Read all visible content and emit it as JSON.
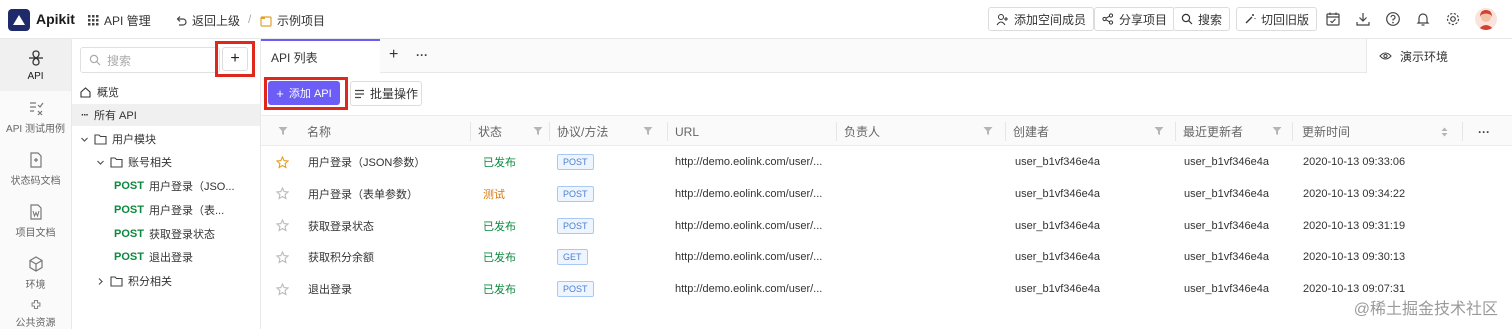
{
  "topbar": {
    "app_name": "Apikit",
    "api_manage": "API 管理",
    "back": "返回上级",
    "sep": "/",
    "project": "示例项目",
    "add_member": "添加空间成员",
    "share": "分享项目",
    "search": "搜索",
    "switch_old": "切回旧版"
  },
  "rail": {
    "items": [
      {
        "label": "API",
        "icon": "api-icon"
      },
      {
        "label": "API 测试用例",
        "icon": "test-case-icon"
      },
      {
        "label": "状态码文档",
        "icon": "status-doc-icon"
      },
      {
        "label": "项目文档",
        "icon": "word-doc-icon"
      },
      {
        "label": "环境",
        "icon": "environment-icon"
      },
      {
        "label": "公共资源",
        "icon": "public-resource-icon"
      }
    ]
  },
  "tree": {
    "search_placeholder": "搜索",
    "plus": "+",
    "overview": "概览",
    "all_api": "所有 API",
    "module_user": "用户模块",
    "group_account": "账号相关",
    "endpoints": [
      {
        "method": "POST",
        "name": "用户登录（JSO..."
      },
      {
        "method": "POST",
        "name": "用户登录（表..."
      },
      {
        "method": "POST",
        "name": "获取登录状态"
      },
      {
        "method": "POST",
        "name": "退出登录"
      }
    ],
    "group_points": "积分相关"
  },
  "tabs": {
    "active": "API 列表",
    "add": "+",
    "more": "···",
    "env": "演示环境"
  },
  "toolbar": {
    "add_api": "添加 API",
    "bulk": "批量操作"
  },
  "table": {
    "headers": [
      "名称",
      "状态",
      "协议/方法",
      "URL",
      "负责人",
      "创建者",
      "最近更新者",
      "更新时间"
    ],
    "more": "···",
    "rows": [
      {
        "starred": true,
        "name": "用户登录（JSON参数）",
        "status": "已发布",
        "status_type": "ok",
        "method": "POST",
        "url": "http://demo.eolink.com/user/...",
        "owner": "",
        "creator": "user_b1vf346e4a",
        "updater": "user_b1vf346e4a",
        "time": "2020-10-13 09:33:06"
      },
      {
        "starred": false,
        "name": "用户登录（表单参数）",
        "status": "测试",
        "status_type": "test",
        "method": "POST",
        "url": "http://demo.eolink.com/user/...",
        "owner": "",
        "creator": "user_b1vf346e4a",
        "updater": "user_b1vf346e4a",
        "time": "2020-10-13 09:34:22"
      },
      {
        "starred": false,
        "name": "获取登录状态",
        "status": "已发布",
        "status_type": "ok",
        "method": "POST",
        "url": "http://demo.eolink.com/user/...",
        "owner": "",
        "creator": "user_b1vf346e4a",
        "updater": "user_b1vf346e4a",
        "time": "2020-10-13 09:31:19"
      },
      {
        "starred": false,
        "name": "获取积分余额",
        "status": "已发布",
        "status_type": "ok",
        "method": "GET",
        "url": "http://demo.eolink.com/user/...",
        "owner": "",
        "creator": "user_b1vf346e4a",
        "updater": "user_b1vf346e4a",
        "time": "2020-10-13 09:30:13"
      },
      {
        "starred": false,
        "name": "退出登录",
        "status": "已发布",
        "status_type": "ok",
        "method": "POST",
        "url": "http://demo.eolink.com/user/...",
        "owner": "",
        "creator": "user_b1vf346e4a",
        "updater": "user_b1vf346e4a",
        "time": "2020-10-13 09:07:31"
      }
    ]
  },
  "watermark": "@稀土掘金技术社区",
  "colors": {
    "accent": "#6b5df6",
    "highlight_box": "#e0271c",
    "published": "#0b8a3f",
    "testing": "#d97706",
    "logo_bg": "#1f2a6b"
  }
}
